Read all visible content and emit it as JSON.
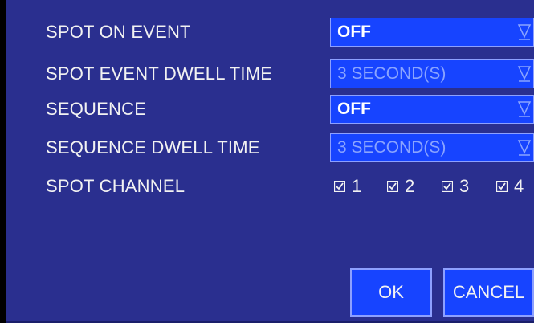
{
  "settings": [
    {
      "label": "SPOT ON EVENT",
      "value": "OFF",
      "enabled": true
    },
    {
      "label": "SPOT EVENT DWELL TIME",
      "value": "3 SECOND(S)",
      "enabled": false
    },
    {
      "label": "SEQUENCE",
      "value": "OFF",
      "enabled": true
    },
    {
      "label": "SEQUENCE DWELL TIME",
      "value": "3 SECOND(S)",
      "enabled": false
    }
  ],
  "spot_channel": {
    "label": "SPOT CHANNEL",
    "channels": [
      {
        "num": "1",
        "checked": true
      },
      {
        "num": "2",
        "checked": true
      },
      {
        "num": "3",
        "checked": true
      },
      {
        "num": "4",
        "checked": true
      }
    ]
  },
  "buttons": {
    "ok": "OK",
    "cancel": "CANCEL"
  },
  "icons": {
    "dropdown": "dropdown-arrow-icon",
    "checkbox": "checkbox-checked-icon"
  },
  "colors": {
    "background": "#2a2f8f",
    "field": "#1744ff",
    "text": "#f2f2f2",
    "disabled_text": "#8aa4ff"
  }
}
